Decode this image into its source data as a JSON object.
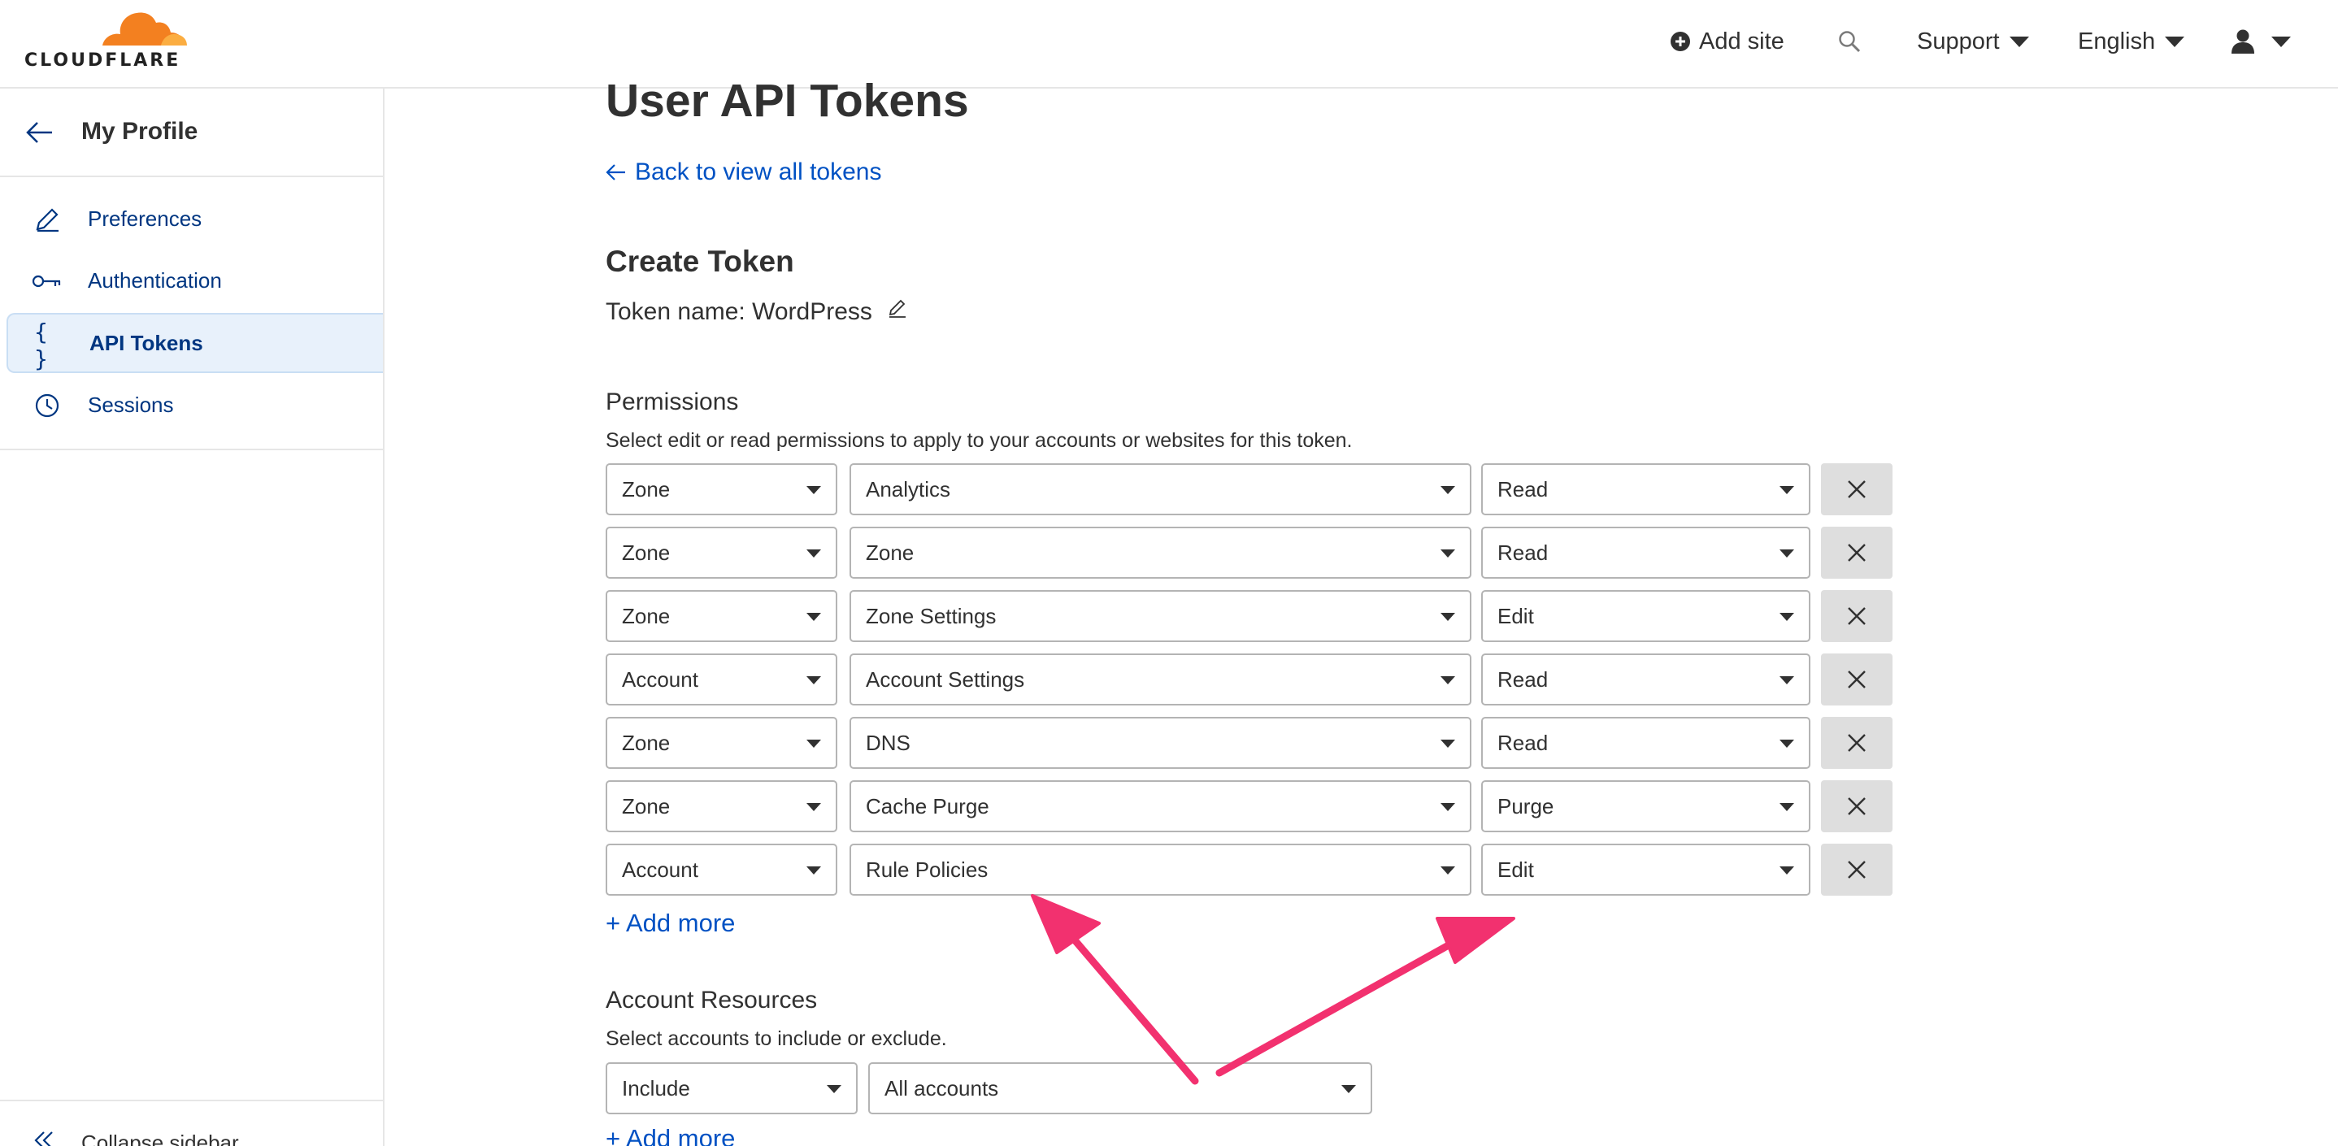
{
  "header": {
    "brand": "CLOUDFLARE",
    "add_site": "Add site",
    "support": "Support",
    "language": "English"
  },
  "sidebar": {
    "title": "My Profile",
    "items": [
      {
        "label": "Preferences",
        "icon": "pencil-icon"
      },
      {
        "label": "Authentication",
        "icon": "key-icon"
      },
      {
        "label": "API Tokens",
        "icon": "braces-icon",
        "active": true
      },
      {
        "label": "Sessions",
        "icon": "clock-icon"
      }
    ],
    "collapse": "Collapse sidebar"
  },
  "main": {
    "page_title": "User API Tokens",
    "back_link": "Back to view all tokens",
    "section_title": "Create Token",
    "token_name": "Token name: WordPress",
    "permissions": {
      "title": "Permissions",
      "description": "Select edit or read permissions to apply to your accounts or websites for this token.",
      "rows": [
        {
          "scope": "Zone",
          "resource": "Analytics",
          "level": "Read"
        },
        {
          "scope": "Zone",
          "resource": "Zone",
          "level": "Read"
        },
        {
          "scope": "Zone",
          "resource": "Zone Settings",
          "level": "Edit"
        },
        {
          "scope": "Account",
          "resource": "Account Settings",
          "level": "Read"
        },
        {
          "scope": "Zone",
          "resource": "DNS",
          "level": "Read"
        },
        {
          "scope": "Zone",
          "resource": "Cache Purge",
          "level": "Purge"
        },
        {
          "scope": "Account",
          "resource": "Rule Policies",
          "level": "Edit"
        }
      ],
      "add_more": "+ Add more"
    },
    "account_resources": {
      "title": "Account Resources",
      "description": "Select accounts to include or exclude.",
      "include": "Include",
      "accounts": "All accounts",
      "add_more": "+ Add more"
    }
  },
  "colors": {
    "link": "#0051c3",
    "brand_orange": "#f38020",
    "annotation_arrow": "#f2316f",
    "active_bg": "#e8f1fb"
  }
}
